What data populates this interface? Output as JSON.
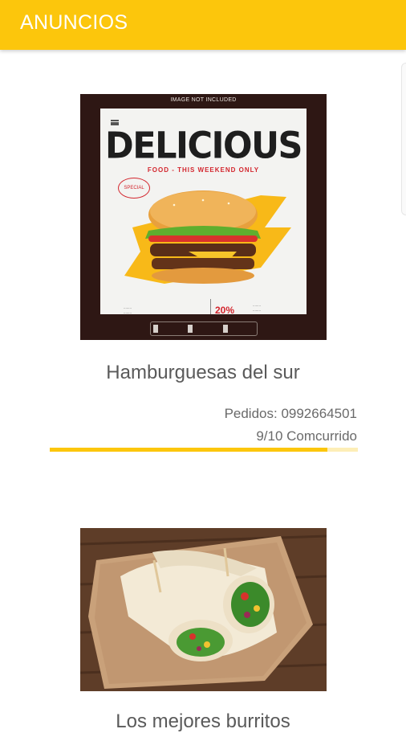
{
  "app": {
    "title": "ANUNCIOS",
    "accent_color": "#fcc60c"
  },
  "ads": [
    {
      "name": "Hamburguesas del sur",
      "phone_line": "Pedidos: 0992664501",
      "crowd_label": "9/10 Comcurrido",
      "crowd_level": 0.9,
      "image": {
        "note": "IMAGE NOT INCLUDED",
        "headline": "DELICIOUS",
        "tagline": "FOOD - THIS WEEKEND ONLY",
        "stamp": "SPECIAL",
        "phone": "096-6522-860",
        "discount": "20%"
      }
    },
    {
      "name": "Los mejores burritos",
      "image_icon": "burrito-photo"
    }
  ]
}
